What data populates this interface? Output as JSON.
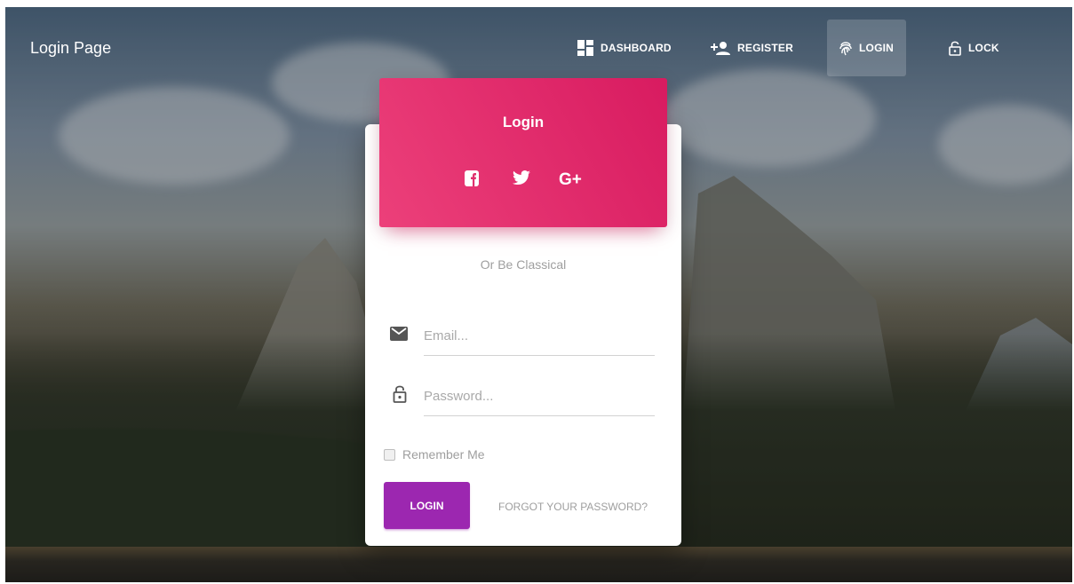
{
  "brand": {
    "title": "Login Page"
  },
  "nav": {
    "items": [
      {
        "label": "DASHBOARD",
        "icon": "dashboard-icon"
      },
      {
        "label": "REGISTER",
        "icon": "person-add-icon"
      },
      {
        "label": "LOGIN",
        "icon": "fingerprint-icon",
        "active": true
      },
      {
        "label": "LOCK",
        "icon": "lock-open-icon"
      }
    ]
  },
  "card": {
    "header_title": "Login",
    "social": [
      "facebook-icon",
      "twitter-icon",
      "google-plus-icon"
    ],
    "google_plus_text": "G+",
    "divider_text": "Or Be Classical",
    "email_placeholder": "Email...",
    "password_placeholder": "Password...",
    "remember_label": "Remember Me",
    "login_button": "LOGIN",
    "forgot_link": "FORGOT YOUR PASSWORD?"
  },
  "colors": {
    "header_gradient_start": "#ec407a",
    "header_gradient_end": "#d81b60",
    "button": "#9c27b0",
    "muted_text": "#9e9e9e"
  }
}
